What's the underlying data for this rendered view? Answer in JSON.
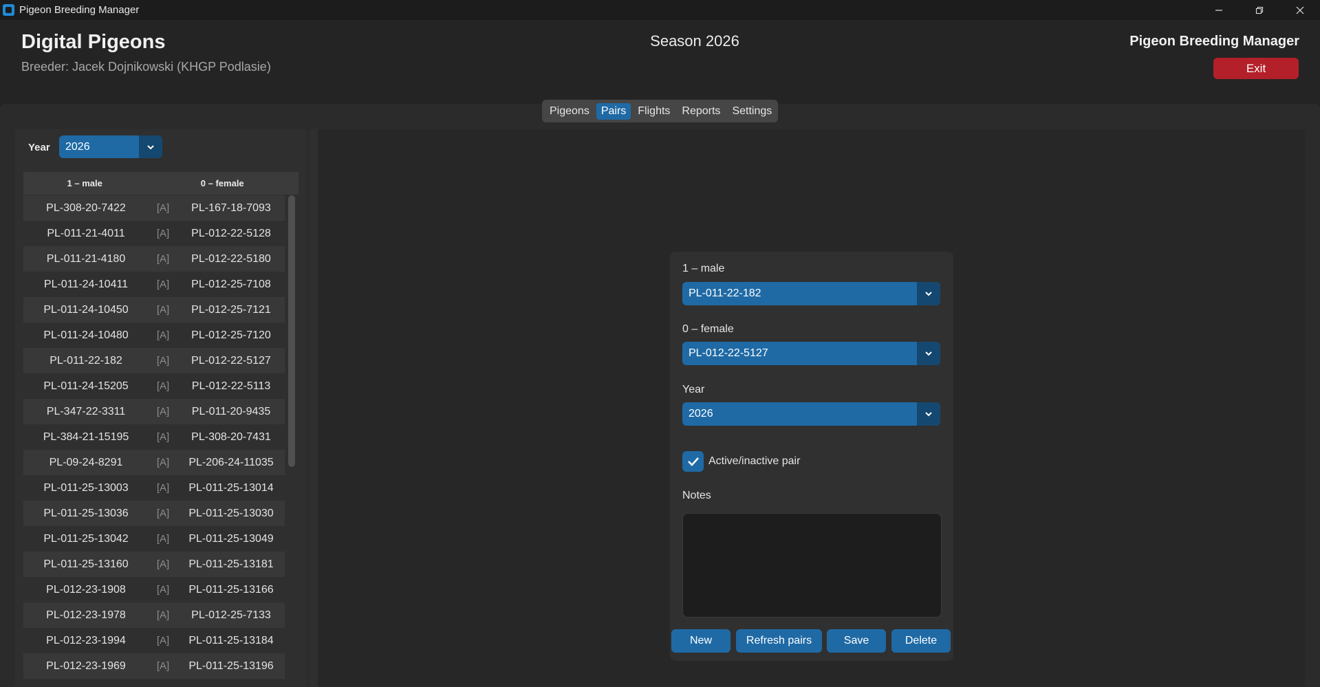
{
  "window": {
    "title": "Pigeon Breeding Manager"
  },
  "header": {
    "app_name": "Digital Pigeons",
    "breeder": "Breeder: Jacek Dojnikowski (KHGP Podlasie)",
    "season": "Season 2026",
    "right_title": "Pigeon Breeding Manager",
    "exit_label": "Exit"
  },
  "tabs": [
    {
      "label": "Pigeons",
      "active": false
    },
    {
      "label": "Pairs",
      "active": true
    },
    {
      "label": "Flights",
      "active": false
    },
    {
      "label": "Reports",
      "active": false
    },
    {
      "label": "Settings",
      "active": false
    }
  ],
  "left_panel": {
    "year_label": "Year",
    "year_value": "2026",
    "columns": {
      "male": "1 – male",
      "female": "0 – female"
    },
    "pairs": [
      {
        "male": "PL-308-20-7422",
        "status": "[A]",
        "female": "PL-167-18-7093"
      },
      {
        "male": "PL-011-21-4011",
        "status": "[A]",
        "female": "PL-012-22-5128"
      },
      {
        "male": "PL-011-21-4180",
        "status": "[A]",
        "female": "PL-012-22-5180"
      },
      {
        "male": "PL-011-24-10411",
        "status": "[A]",
        "female": "PL-012-25-7108"
      },
      {
        "male": "PL-011-24-10450",
        "status": "[A]",
        "female": "PL-012-25-7121"
      },
      {
        "male": "PL-011-24-10480",
        "status": "[A]",
        "female": "PL-012-25-7120"
      },
      {
        "male": "PL-011-22-182",
        "status": "[A]",
        "female": "PL-012-22-5127"
      },
      {
        "male": "PL-011-24-15205",
        "status": "[A]",
        "female": "PL-012-22-5113"
      },
      {
        "male": "PL-347-22-3311",
        "status": "[A]",
        "female": "PL-011-20-9435"
      },
      {
        "male": "PL-384-21-15195",
        "status": "[A]",
        "female": "PL-308-20-7431"
      },
      {
        "male": "PL-09-24-8291",
        "status": "[A]",
        "female": "PL-206-24-11035"
      },
      {
        "male": "PL-011-25-13003",
        "status": "[A]",
        "female": "PL-011-25-13014"
      },
      {
        "male": "PL-011-25-13036",
        "status": "[A]",
        "female": "PL-011-25-13030"
      },
      {
        "male": "PL-011-25-13042",
        "status": "[A]",
        "female": "PL-011-25-13049"
      },
      {
        "male": "PL-011-25-13160",
        "status": "[A]",
        "female": "PL-011-25-13181"
      },
      {
        "male": "PL-012-23-1908",
        "status": "[A]",
        "female": "PL-011-25-13166"
      },
      {
        "male": "PL-012-23-1978",
        "status": "[A]",
        "female": "PL-012-25-7133"
      },
      {
        "male": "PL-012-23-1994",
        "status": "[A]",
        "female": "PL-011-25-13184"
      },
      {
        "male": "PL-012-23-1969",
        "status": "[A]",
        "female": "PL-011-25-13196"
      }
    ]
  },
  "form": {
    "male_label": "1 – male",
    "male_value": "PL-011-22-182",
    "female_label": "0 – female",
    "female_value": "PL-012-22-5127",
    "year_label": "Year",
    "year_value": "2026",
    "active_label": "Active/inactive pair",
    "active_checked": true,
    "notes_label": "Notes",
    "notes_value": "",
    "buttons": {
      "new": "New",
      "refresh": "Refresh pairs",
      "save": "Save",
      "delete": "Delete"
    }
  },
  "colors": {
    "accent": "#1f6aa5",
    "accent_dark": "#144870",
    "danger": "#b3202a",
    "background": "#242424"
  }
}
